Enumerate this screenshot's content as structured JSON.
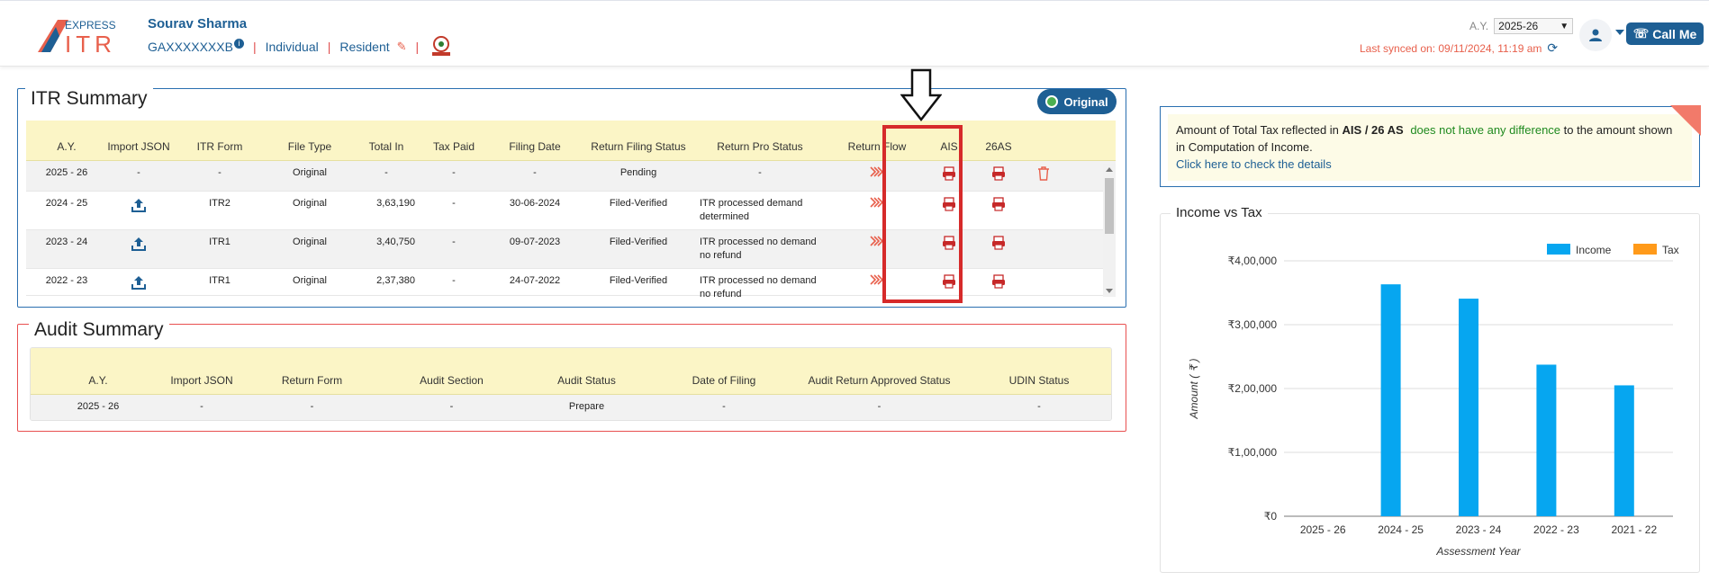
{
  "header": {
    "logo_top": "EXPRESS",
    "logo_main": "ITR",
    "user_name": "Sourav Sharma",
    "pan": "GAXXXXXXXB",
    "pan_info": "i",
    "status_individual": "Individual",
    "status_resident": "Resident",
    "ay_label": "A.Y.",
    "ay_value": "2025-26",
    "last_synced": "Last synced on: 09/11/2024, 11:19 am",
    "call_me": "Call Me"
  },
  "itr_summary": {
    "title": "ITR Summary",
    "badge": "Original",
    "columns": [
      "A.Y.",
      "Import JSON",
      "ITR Form",
      "File Type",
      "Total In",
      "Tax Paid",
      "Filing Date",
      "Return Filing Status",
      "Return Pro Status",
      "Return Flow",
      "AIS",
      "26AS"
    ],
    "rows": [
      {
        "ay": "2025 - 26",
        "import": "-",
        "form": "-",
        "file_type": "Original",
        "total_in": "-",
        "tax_paid": "-",
        "filing_date": "-",
        "filing_status": "Pending",
        "pro_status": "-"
      },
      {
        "ay": "2024 - 25",
        "import": "upload",
        "form": "ITR2",
        "file_type": "Original",
        "total_in": "3,63,190",
        "tax_paid": "-",
        "filing_date": "30-06-2024",
        "filing_status": "Filed-Verified",
        "pro_status": "ITR processed demand determined"
      },
      {
        "ay": "2023 - 24",
        "import": "upload",
        "form": "ITR1",
        "file_type": "Original",
        "total_in": "3,40,750",
        "tax_paid": "-",
        "filing_date": "09-07-2023",
        "filing_status": "Filed-Verified",
        "pro_status": "ITR processed no demand no refund"
      },
      {
        "ay": "2022 - 23",
        "import": "upload",
        "form": "ITR1",
        "file_type": "Original",
        "total_in": "2,37,380",
        "tax_paid": "-",
        "filing_date": "24-07-2022",
        "filing_status": "Filed-Verified",
        "pro_status": "ITR processed no demand no refund"
      }
    ]
  },
  "audit_summary": {
    "title": "Audit Summary",
    "columns": [
      "A.Y.",
      "Import JSON",
      "Return Form",
      "Audit Section",
      "Audit Status",
      "Date of Filing",
      "Audit Return Approved Status",
      "UDIN Status"
    ],
    "rows": [
      {
        "ay": "2025 - 26",
        "import": "-",
        "form": "-",
        "section": "-",
        "status": "Prepare",
        "date": "-",
        "approved": "-",
        "udin": "-"
      }
    ]
  },
  "notice": {
    "text_before": "Amount of Total Tax reflected in",
    "bold": "AIS / 26 AS",
    "green": "does not have any difference",
    "text_after": "to the amount shown in Computation of Income.",
    "link": "Click here to check the details"
  },
  "chart_title": "Income vs Tax",
  "chart_data": {
    "type": "bar",
    "categories": [
      "2025 - 26",
      "2024 - 25",
      "2023 - 24",
      "2022 - 23",
      "2021 - 22"
    ],
    "series": [
      {
        "name": "Income",
        "values": [
          0,
          363190,
          340750,
          237380,
          205000
        ],
        "color": "#06a6f0"
      },
      {
        "name": "Tax",
        "values": [
          0,
          0,
          0,
          0,
          0
        ],
        "color": "#ff9a1a"
      }
    ],
    "xlabel": "Assessment Year",
    "ylabel": "Amount ( ₹ )",
    "ylim": [
      0,
      400000
    ],
    "yticks": [
      0,
      100000,
      200000,
      300000,
      400000
    ],
    "ytick_labels": [
      "₹0",
      "₹1,00,000",
      "₹2,00,000",
      "₹3,00,000",
      "₹4,00,000"
    ],
    "grid": true,
    "legend": "top-right"
  }
}
